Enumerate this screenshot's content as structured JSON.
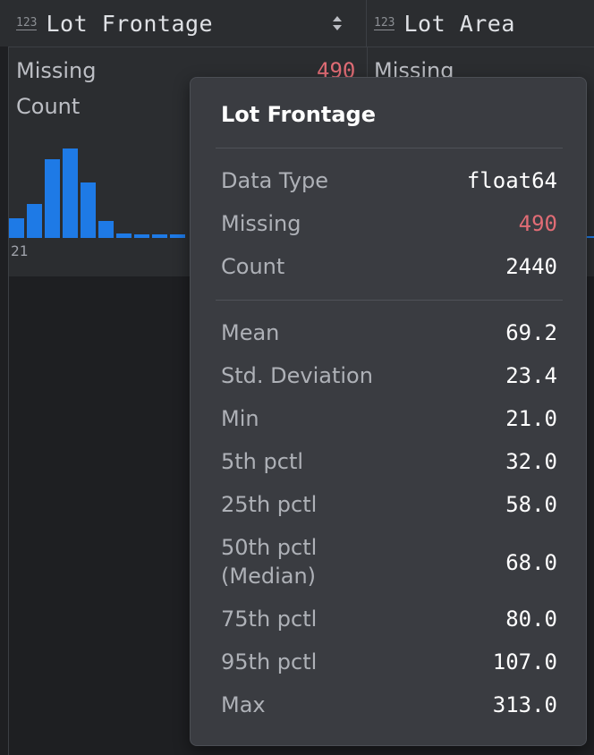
{
  "columns": [
    {
      "type_icon": "123",
      "title": "Lot Frontage"
    },
    {
      "type_icon": "123",
      "title": "Lot Area"
    }
  ],
  "summary": {
    "missing_label": "Missing",
    "missing_value": "490",
    "count_label": "Count",
    "second_missing_label": "Missing",
    "hist_min_tick": "21"
  },
  "chart_data": {
    "type": "bar",
    "values": [
      22,
      38,
      88,
      100,
      62,
      19,
      5,
      4,
      4,
      4
    ],
    "note": "relative bin heights"
  },
  "tooltip": {
    "title": "Lot Frontage",
    "group1": [
      {
        "label": "Data Type",
        "value": "float64"
      },
      {
        "label": "Missing",
        "value": "490",
        "red": true
      },
      {
        "label": "Count",
        "value": "2440"
      }
    ],
    "group2": [
      {
        "label": "Mean",
        "value": "69.2"
      },
      {
        "label": "Std. Deviation",
        "value": "23.4"
      },
      {
        "label": "Min",
        "value": "21.0"
      },
      {
        "label": "5th pctl",
        "value": "32.0"
      },
      {
        "label": "25th pctl",
        "value": "58.0"
      },
      {
        "label": "50th pctl",
        "label2": "(Median)",
        "value": "68.0"
      },
      {
        "label": "75th pctl",
        "value": "80.0"
      },
      {
        "label": "95th pctl",
        "value": "107.0"
      },
      {
        "label": "Max",
        "value": "313.0"
      }
    ]
  },
  "colors": {
    "bar": "#1e7ae6",
    "missing": "#e06c75"
  }
}
